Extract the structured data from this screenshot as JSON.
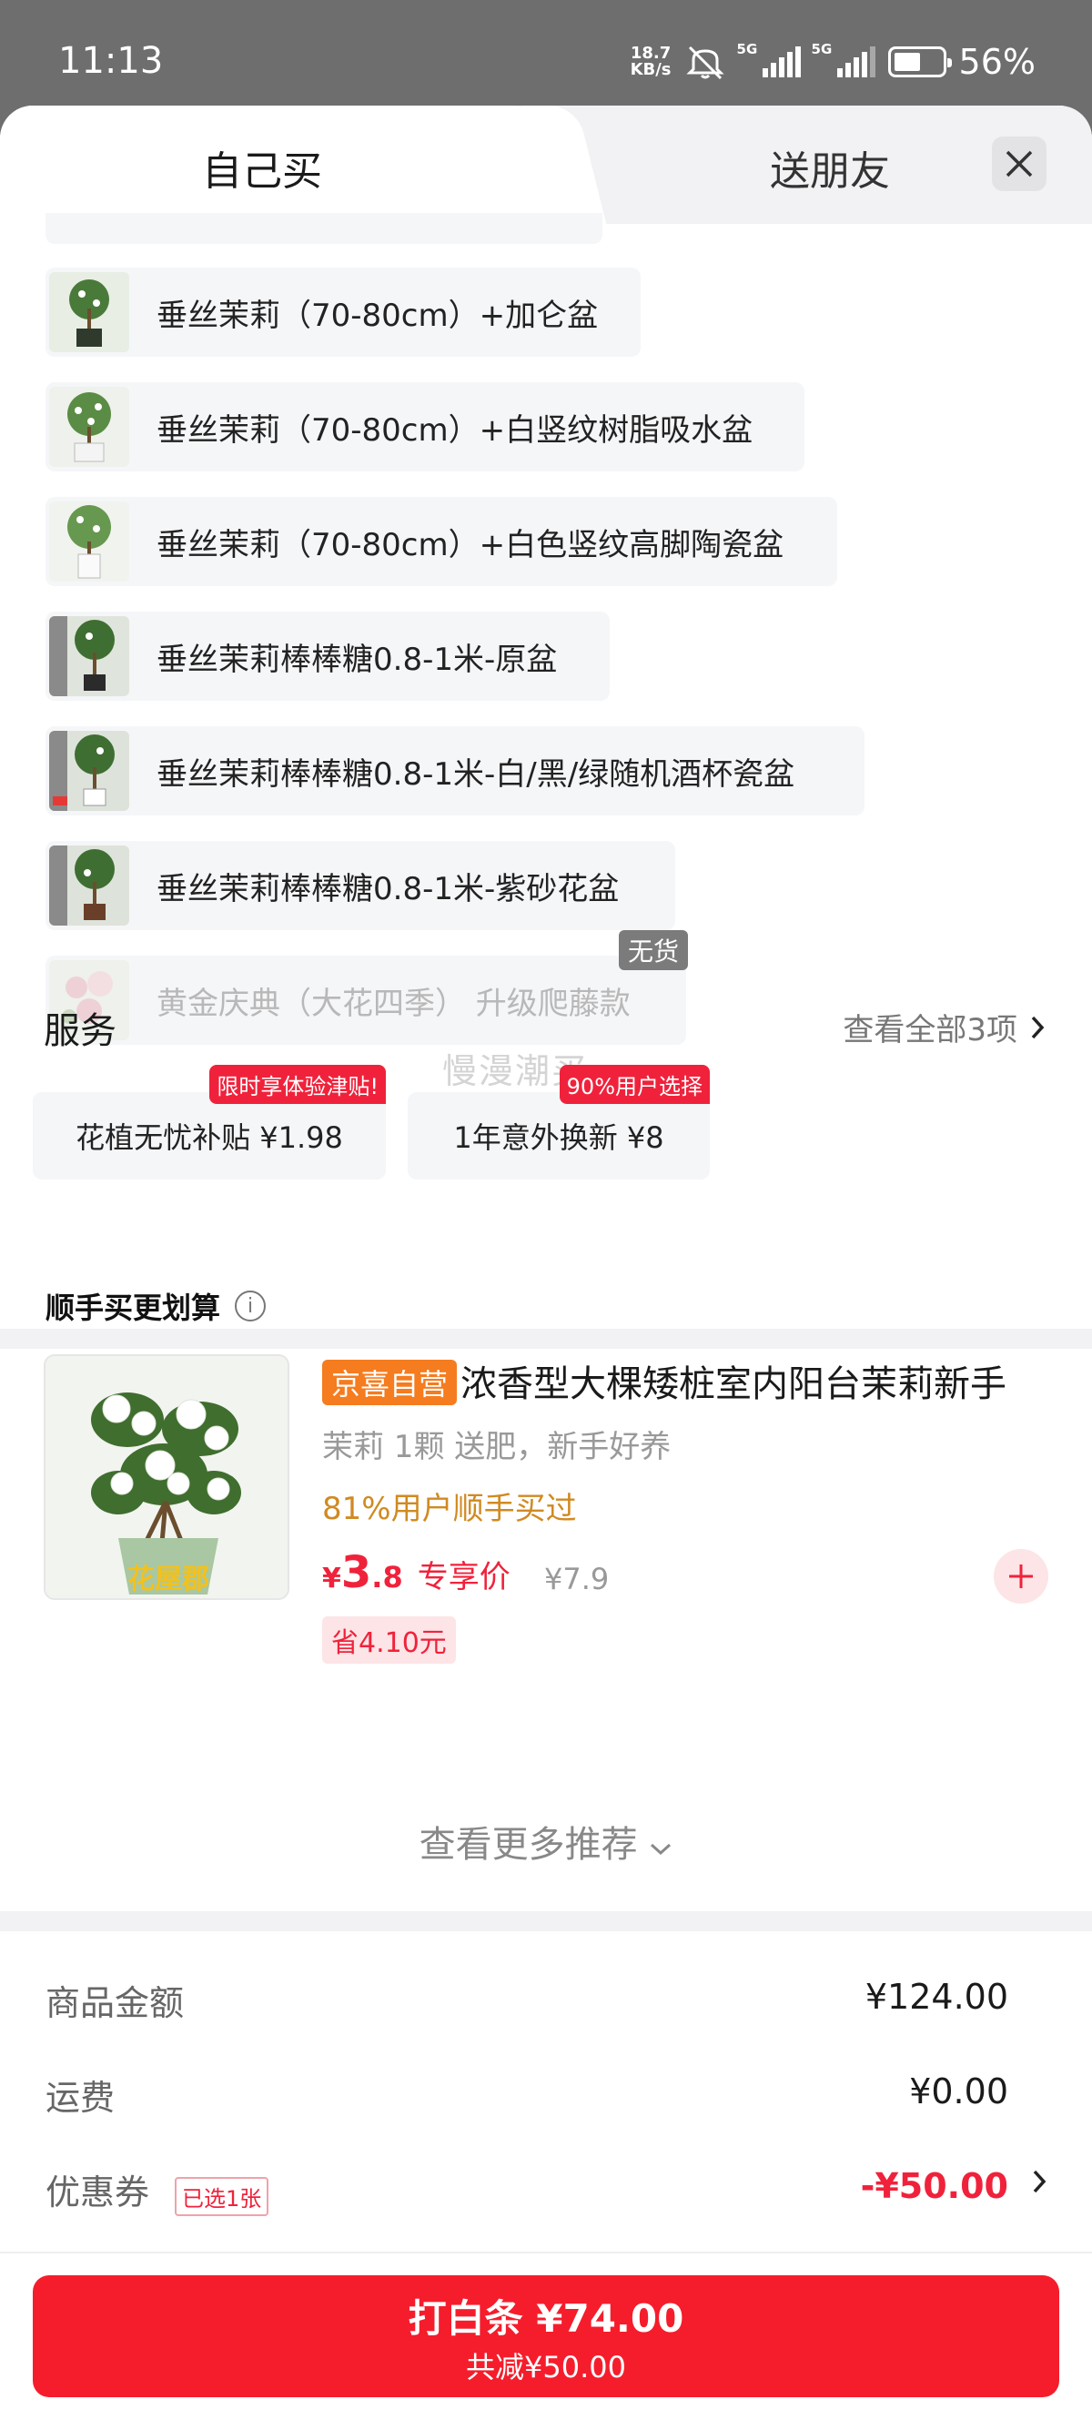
{
  "status_bar": {
    "time": "11:13",
    "net_speed_top": "18.7",
    "net_speed_bottom": "KB/s",
    "sim1_label": "5G",
    "sim2_label": "5G",
    "battery_percent": "56%",
    "battery_level": 0.56
  },
  "tabs": {
    "self_buy": "自己买",
    "gift_friend": "送朋友"
  },
  "variants": [
    {
      "label": "垂丝茉莉（70-80cm）+加仑盆",
      "available": true
    },
    {
      "label": "垂丝茉莉（70-80cm）+白竖纹树脂吸水盆",
      "available": true
    },
    {
      "label": "垂丝茉莉（70-80cm）+白色竖纹高脚陶瓷盆",
      "available": true
    },
    {
      "label": "垂丝茉莉棒棒糖0.8-1米-原盆",
      "available": true
    },
    {
      "label": "垂丝茉莉棒棒糖0.8-1米-白/黑/绿随机酒杯瓷盆",
      "available": true
    },
    {
      "label": "垂丝茉莉棒棒糖0.8-1米-紫砂花盆",
      "available": true
    },
    {
      "label": "黄金庆典（大花四季） 升级爬藤款",
      "available": false
    }
  ],
  "no_stock_label": "无货",
  "service": {
    "title": "服务",
    "see_all": "查看全部3项",
    "items": [
      {
        "label": "花植无忧补贴  ¥1.98",
        "badge": "限时享体验津贴!"
      },
      {
        "label": "1年意外换新  ¥8",
        "badge": "90%用户选择"
      }
    ],
    "watermark": "慢漫潮买"
  },
  "recommend": {
    "title": "顺手买更划算",
    "tag": "京喜自营",
    "product_name": "浓香型大棵矮桩室内阳台茉莉新手",
    "desc": "茉莉 1颗 送肥，新手好养",
    "buyers": "81%用户顺手买过",
    "price_currency": "¥",
    "price_int": "3",
    "price_dec": ".8",
    "price_label": "专享价",
    "original_price": "¥7.9",
    "save": "省4.10元",
    "image_text": "花屋郡",
    "see_more": "查看更多推荐"
  },
  "summary": {
    "goods_label": "商品金额",
    "goods_value": "¥124.00",
    "shipping_label": "运费",
    "shipping_value": "¥0.00",
    "coupon_label": "优惠券",
    "coupon_badge": "已选1张",
    "coupon_value": "-¥50.00"
  },
  "pay": {
    "main": "打白条 ¥74.00",
    "sub": "共减¥50.00"
  },
  "colors": {
    "accent_red": "#f51d2c",
    "tag_orange": "#f57c1f",
    "buyers_gold": "#d08a22"
  }
}
